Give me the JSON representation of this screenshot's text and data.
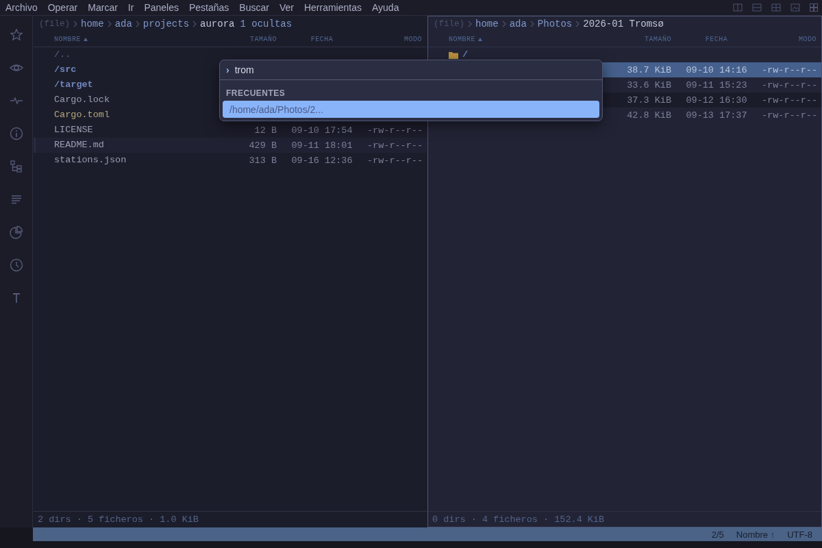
{
  "menu": [
    "Archivo",
    "Operar",
    "Marcar",
    "Ir",
    "Paneles",
    "Pestañas",
    "Buscar",
    "Ver",
    "Herramientas",
    "Ayuda"
  ],
  "panes": [
    {
      "active": false,
      "breadcrumb": [
        {
          "text": "(file)",
          "kind": "scheme"
        },
        {
          "text": "home",
          "kind": "dir"
        },
        {
          "text": "ada",
          "kind": "dir"
        },
        {
          "text": "projects",
          "kind": "dir"
        },
        {
          "text": "aurora",
          "kind": "current"
        }
      ],
      "hidden_note": "1 ocultas",
      "columns": [
        "NOMBRE",
        "TAMAÑO",
        "FECHA",
        "MODO"
      ],
      "rows": [
        {
          "name": "/..",
          "kind": "parent",
          "selected": false,
          "cursor": false
        },
        {
          "name": "/src",
          "kind": "dir",
          "selected": false,
          "cursor": false
        },
        {
          "name": "/target",
          "kind": "dir",
          "selected": false,
          "cursor": false
        },
        {
          "name": "Cargo.lock",
          "kind": "file",
          "selected": false,
          "cursor": false
        },
        {
          "name": "Cargo.toml",
          "kind": "config",
          "selected": false,
          "cursor": false
        },
        {
          "name": "LICENSE",
          "kind": "file",
          "size": "12 B",
          "date": "09-10 17:54",
          "mode": "-rw-r--r--",
          "selected": false,
          "cursor": false
        },
        {
          "name": "README.md",
          "kind": "file",
          "size": "429 B",
          "date": "09-11 18:01",
          "mode": "-rw-r--r--",
          "selected": false,
          "cursor": true
        },
        {
          "name": "stations.json",
          "kind": "file",
          "size": "313 B",
          "date": "09-16 12:36",
          "mode": "-rw-r--r--",
          "selected": false,
          "cursor": false
        }
      ],
      "footer": "2 dirs · 5 ficheros · 1.0 KiB"
    },
    {
      "active": true,
      "breadcrumb": [
        {
          "text": "(file)",
          "kind": "scheme"
        },
        {
          "text": "home",
          "kind": "dir"
        },
        {
          "text": "ada",
          "kind": "dir"
        },
        {
          "text": "Photos",
          "kind": "dir"
        },
        {
          "text": "2026-01 Tromsø",
          "kind": "current"
        }
      ],
      "columns": [
        "NOMBRE",
        "TAMAÑO",
        "FECHA",
        "MODO"
      ],
      "rows": [
        {
          "name": "/",
          "kind": "folder",
          "selected": false,
          "cursor": false
        },
        {
          "kind": "image",
          "size": "38.7 KiB",
          "date": "09-10 14:16",
          "mode": "-rw-r--r--",
          "selected": true,
          "cursor": false
        },
        {
          "kind": "image",
          "size": "33.6 KiB",
          "date": "09-11 15:23",
          "mode": "-rw-r--r--",
          "selected": false,
          "cursor": false
        },
        {
          "kind": "image",
          "size": "37.3 KiB",
          "date": "09-12 16:30",
          "mode": "-rw-r--r--",
          "selected": false,
          "cursor": true
        },
        {
          "kind": "image",
          "size": "42.8 KiB",
          "date": "09-13 17:37",
          "mode": "-rw-r--r--",
          "selected": false,
          "cursor": false
        }
      ],
      "footer": "0 dirs · 4 ficheros · 152.4 KiB"
    }
  ],
  "popup": {
    "prompt": "›",
    "query": "trom",
    "section": "FRECUENTES",
    "items": [
      {
        "text": "/home/ada/Photos/2...",
        "selected": true
      }
    ]
  },
  "status_bar": [
    "2/5",
    "Nombre ↑",
    "UTF-8"
  ]
}
